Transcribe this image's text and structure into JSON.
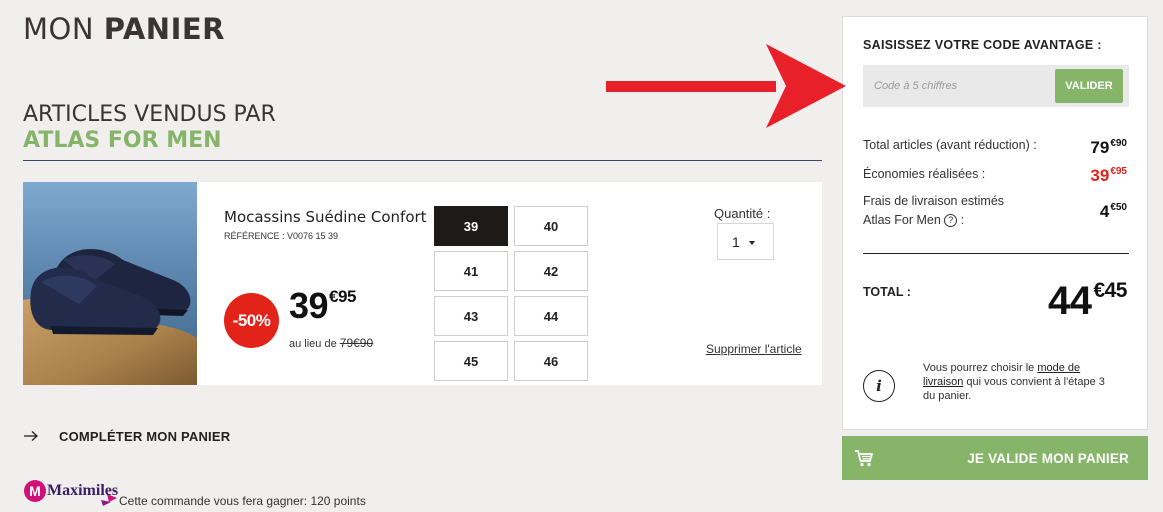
{
  "header": {
    "title_light": "MON ",
    "title_bold": "PANIER"
  },
  "seller": {
    "heading": "ARTICLES VENDUS PAR",
    "name": "ATLAS FOR MEN"
  },
  "product": {
    "name": "Mocassins Suédine Confort",
    "reference": "RÉFÉRENCE : V0076 15 39",
    "discount": "-50%",
    "price_main": "39",
    "price_cents": "€95",
    "old_price_prefix": "au lieu de ",
    "old_price": "79€90",
    "sizes": [
      "39",
      "40",
      "41",
      "42",
      "43",
      "44",
      "45",
      "46"
    ],
    "selected_size": "39",
    "quantity_label": "Quantité :",
    "quantity": "1",
    "remove_label": "Supprimer l'article"
  },
  "complete_cart": {
    "label": "COMPLÉTER MON PANIER"
  },
  "loyalty": {
    "logo_text": "Maximiles",
    "points_text": "Cette commande vous fera gagner: 120 points"
  },
  "sidebar": {
    "promo_title": "SAISISSEZ VOTRE CODE AVANTAGE :",
    "promo_placeholder": "Code à 5 chiffres",
    "promo_button": "VALIDER",
    "lines": {
      "total_articles_label": "Total articles (avant réduction) :",
      "total_articles_main": "79",
      "total_articles_cents": "€90",
      "savings_label": "Économies réalisées :",
      "savings_main": "39",
      "savings_cents": "€95",
      "shipping_label_1": "Frais de livraison estimés",
      "shipping_label_2": "Atlas For Men",
      "shipping_label_3": " :",
      "shipping_help": "?",
      "shipping_main": "4",
      "shipping_cents": "€50"
    },
    "total_label": "TOTAL :",
    "total_main": "44",
    "total_cents": "€45",
    "info_icon": "i",
    "info_text_1": "Vous pourrez choisir le ",
    "info_link": "mode de livraison",
    "info_text_2": " qui vous convient à l'étape 3 du panier."
  },
  "validate_button": "JE VALIDE MON PANIER",
  "colors": {
    "accent_green": "#86b56a",
    "discount_red": "#e2231a",
    "annotation_red": "#e8202a",
    "dark": "#1e1a18"
  },
  "icons": [
    "arrow-right-icon",
    "cart-icon",
    "info-icon",
    "help-icon",
    "chevron-down-icon",
    "maximiles-logo",
    "annotation-arrow"
  ]
}
